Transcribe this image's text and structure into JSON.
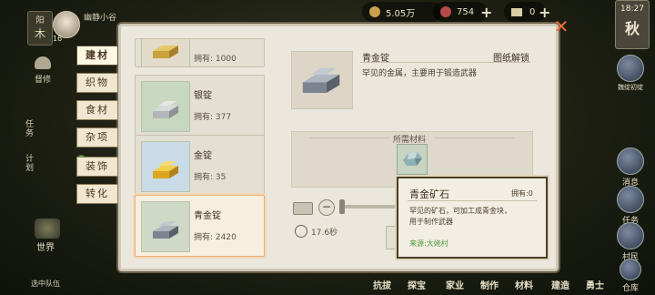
{
  "hud": {
    "player_name": "幽静小谷",
    "level": "16",
    "season_top": "1",
    "copper": "5.05万",
    "spirit": "754",
    "ticket": "0",
    "time": "18:27",
    "season": "秋"
  },
  "left_side": {
    "label_a": "任务",
    "label_b": "计划",
    "top_small": "阳",
    "top_glyph": "木",
    "building_label": "督修",
    "world_label": "世界",
    "team_label": "选中队伍"
  },
  "tabs": [
    {
      "label": "建材"
    },
    {
      "label": "织物"
    },
    {
      "label": "食材"
    },
    {
      "label": "杂项"
    },
    {
      "label": "装饰"
    },
    {
      "label": "转化"
    }
  ],
  "items": [
    {
      "name": "",
      "own": "拥有: 1000"
    },
    {
      "name": "银锭",
      "own": "拥有: 377"
    },
    {
      "name": "金锭",
      "own": "拥有: 35"
    },
    {
      "name": "青金锭",
      "own": "拥有: 2420"
    }
  ],
  "detail": {
    "title": "青金锭",
    "unlock": "图纸解锁",
    "desc": "罕见的金属，主要用于锻造武器",
    "materials_label": "所需材料",
    "time": "17.6秒",
    "qty_min": "1"
  },
  "popup": {
    "title": "青金矿石",
    "own": "拥有:0",
    "desc_line1": "罕见的矿石，可加工成青金块，",
    "desc_line2": "用于制作武器",
    "source": "来源:大姥村"
  },
  "right_side": {
    "event": "魏绽初绽",
    "msg": "消息",
    "task": "任务",
    "resident": "村民",
    "warehouse": "仓库"
  },
  "bottom_nav": [
    "抗拔",
    "探宝",
    "家业",
    "制作",
    "材料",
    "建造",
    "勇士"
  ]
}
